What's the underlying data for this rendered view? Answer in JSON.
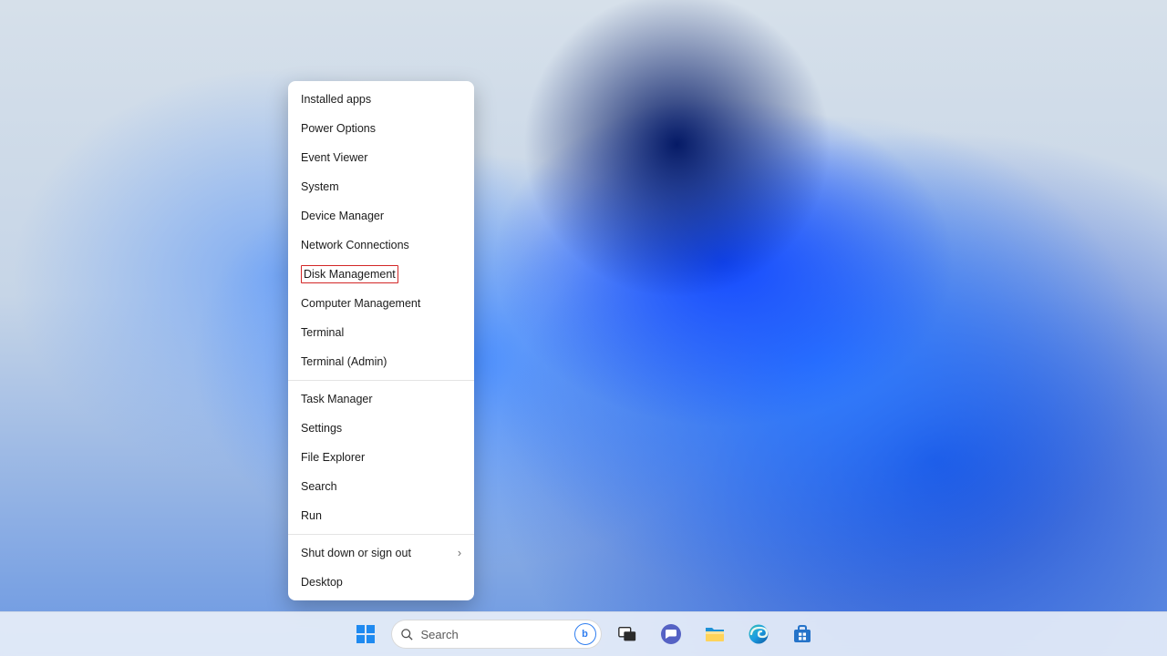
{
  "winx_menu": {
    "groups": [
      [
        {
          "key": "installed-apps",
          "label": "Installed apps",
          "submenu": false,
          "highlight": false
        },
        {
          "key": "power-options",
          "label": "Power Options",
          "submenu": false,
          "highlight": false
        },
        {
          "key": "event-viewer",
          "label": "Event Viewer",
          "submenu": false,
          "highlight": false
        },
        {
          "key": "system",
          "label": "System",
          "submenu": false,
          "highlight": false
        },
        {
          "key": "device-manager",
          "label": "Device Manager",
          "submenu": false,
          "highlight": false
        },
        {
          "key": "network-connections",
          "label": "Network Connections",
          "submenu": false,
          "highlight": false
        },
        {
          "key": "disk-management",
          "label": "Disk Management",
          "submenu": false,
          "highlight": true
        },
        {
          "key": "computer-management",
          "label": "Computer Management",
          "submenu": false,
          "highlight": false
        },
        {
          "key": "terminal",
          "label": "Terminal",
          "submenu": false,
          "highlight": false
        },
        {
          "key": "terminal-admin",
          "label": "Terminal (Admin)",
          "submenu": false,
          "highlight": false
        }
      ],
      [
        {
          "key": "task-manager",
          "label": "Task Manager",
          "submenu": false,
          "highlight": false
        },
        {
          "key": "settings",
          "label": "Settings",
          "submenu": false,
          "highlight": false
        },
        {
          "key": "file-explorer",
          "label": "File Explorer",
          "submenu": false,
          "highlight": false
        },
        {
          "key": "search",
          "label": "Search",
          "submenu": false,
          "highlight": false
        },
        {
          "key": "run",
          "label": "Run",
          "submenu": false,
          "highlight": false
        }
      ],
      [
        {
          "key": "shut-down",
          "label": "Shut down or sign out",
          "submenu": true,
          "highlight": false
        },
        {
          "key": "desktop",
          "label": "Desktop",
          "submenu": false,
          "highlight": false
        }
      ]
    ]
  },
  "taskbar": {
    "search_placeholder": "Search",
    "bing_badge": "b",
    "items": [
      {
        "key": "start",
        "name": "start-button"
      },
      {
        "key": "search",
        "name": "search-box"
      },
      {
        "key": "task-view",
        "name": "task-view-button"
      },
      {
        "key": "chat",
        "name": "chat-button"
      },
      {
        "key": "file-explorer",
        "name": "file-explorer-button"
      },
      {
        "key": "edge",
        "name": "edge-button"
      },
      {
        "key": "store",
        "name": "microsoft-store-button"
      }
    ]
  },
  "colors": {
    "highlight_border": "#d22727",
    "accent": "#2f7ef0"
  }
}
